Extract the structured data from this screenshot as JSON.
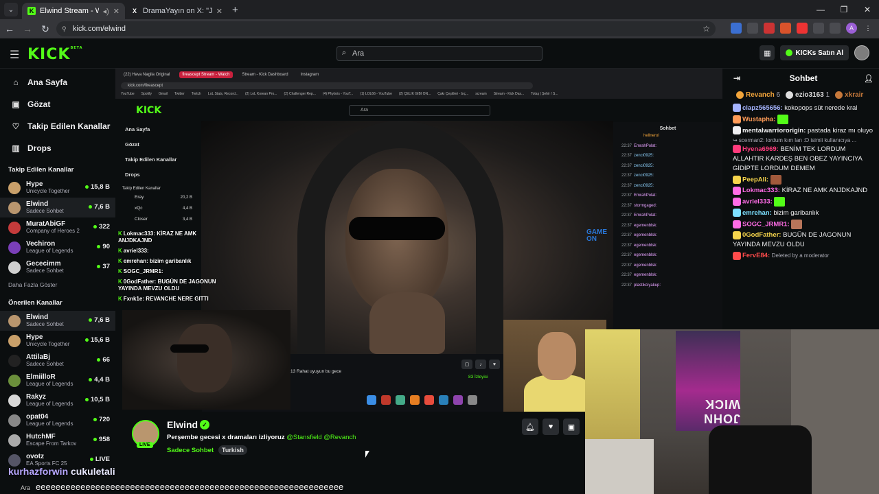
{
  "browser": {
    "tabs": [
      {
        "title": "Elwind Stream - Watch Live",
        "favicon": "K",
        "active": true
      },
      {
        "title": "DramaYayın on X: \"Jahrein ve G",
        "favicon": "X",
        "active": false
      }
    ],
    "url": "kick.com/elwind"
  },
  "topbar": {
    "logo": "KICK",
    "logo_sup": "BETA",
    "search_placeholder": "Ara",
    "kicks_button": "KICKs Satın Al"
  },
  "sidebar": {
    "nav": [
      {
        "label": "Ana Sayfa",
        "icon": "home-icon"
      },
      {
        "label": "Gözat",
        "icon": "browse-icon"
      },
      {
        "label": "Takip Edilen Kanallar",
        "icon": "heart-icon"
      },
      {
        "label": "Drops",
        "icon": "drops-icon"
      }
    ],
    "followed_title": "Takip Edilen Kanallar",
    "followed": [
      {
        "name": "Hype",
        "category": "Unicycle Together",
        "viewers": "15,8 B",
        "color": "#c9a06a"
      },
      {
        "name": "Elwind",
        "category": "Sadece Sohbet",
        "viewers": "7,6 B",
        "color": "#b9966e"
      },
      {
        "name": "MuratAbiGF",
        "category": "Company of Heroes 2",
        "viewers": "322",
        "color": "#c43b3b"
      },
      {
        "name": "Vechiron",
        "category": "League of Legends",
        "viewers": "90",
        "color": "#7a3fb8"
      },
      {
        "name": "Gececimm",
        "category": "Sadece Sohbet",
        "viewers": "37",
        "color": "#d0d0d0"
      }
    ],
    "more_label": "Daha Fazla Göster",
    "recommended_title": "Önerilen Kanallar",
    "recommended": [
      {
        "name": "Elwind",
        "category": "Sadece Sohbet",
        "viewers": "7,6 B",
        "color": "#b9966e"
      },
      {
        "name": "Hype",
        "category": "Unicycle Together",
        "viewers": "15,6 B",
        "color": "#c9a06a"
      },
      {
        "name": "AttilaBj",
        "category": "Sadece Sohbet",
        "viewers": "66",
        "color": "#222"
      },
      {
        "name": "ElmiilloR",
        "category": "League of Legends",
        "viewers": "4,4 B",
        "color": "#6b8f3b"
      },
      {
        "name": "Rakyz",
        "category": "League of Legends",
        "viewers": "10,5 B",
        "color": "#d8d8d8"
      },
      {
        "name": "opat04",
        "category": "League of Legends",
        "viewers": "720",
        "color": "#888"
      },
      {
        "name": "HutchMF",
        "category": "Escape From Tarkov",
        "viewers": "958",
        "color": "#aaa"
      },
      {
        "name": "ovotz",
        "category": "EA Sports FC 25",
        "viewers": "LIVE",
        "color": "#556"
      }
    ]
  },
  "inner_stream": {
    "tabs": [
      "(22) Hava Nagila Original",
      "fireascept Stream - Watch",
      "Stream - Kick Dashboard",
      "Instagram"
    ],
    "url": "kick.com/fireascept",
    "bookmarks": [
      "YouTube",
      "Spotify",
      "Gmail",
      "Twitter",
      "Twitch",
      "LoL Stats, Record...",
      "(2) LoL Korean Pro...",
      "(2) Challenger Rep...",
      "(4) Phylsris - YouT...",
      "(1) LOL66 - YouTube",
      "(2) ÇELIK GIBI ON...",
      "Çakı Çeşitleri - bıç...",
      "scream",
      "Stream - Kick Das...",
      "Totaş | Şehir / S..."
    ],
    "logo": "KICK",
    "search": "Ara",
    "nav": [
      "Ana Sayfa",
      "Gözat",
      "Takip Edilen Kanallar",
      "Drops"
    ],
    "followed_title": "Takip Edilen Kanallar",
    "followed": [
      {
        "name": "Eray",
        "cat": "Darbe Phone",
        "v": "20,2 B"
      },
      {
        "name": "xQc",
        "cat": "Minecraft",
        "v": "4,4 B"
      },
      {
        "name": "Closer",
        "cat": "",
        "v": "3,4 B"
      }
    ],
    "chat_title": "Sohbet",
    "chat_top": "hellnerol",
    "chat_lines": [
      {
        "t": "22:37",
        "u": "EmrahPolat:"
      },
      {
        "t": "22:37",
        "u": "zenci0925:"
      },
      {
        "t": "22:37",
        "u": "zenci0925:"
      },
      {
        "t": "22:37",
        "u": "zenci0925:"
      },
      {
        "t": "22:37",
        "u": "zenci0925:"
      },
      {
        "t": "22:37",
        "u": "EmrahPolat:"
      },
      {
        "t": "22:37",
        "u": "stormgaged:"
      },
      {
        "t": "22:37",
        "u": "EmrahPolat:"
      },
      {
        "t": "22:37",
        "u": "egemenblsk:"
      },
      {
        "t": "22:37",
        "u": "egemenblsk:"
      },
      {
        "t": "22:37",
        "u": "egemenblsk:"
      },
      {
        "t": "22:37",
        "u": "egemenblsk:"
      },
      {
        "t": "22:37",
        "u": "egemenblsk:"
      },
      {
        "t": "22:37",
        "u": "egemenblsk:"
      },
      {
        "t": "22:37",
        "u": "plastikciyakup:"
      }
    ],
    "game_on": [
      "GAME",
      "ON"
    ],
    "song": "13 Rahat uyuyun bu gece",
    "viewers": "83 İzleyici",
    "overlay_chat": [
      {
        "u": "Lokmac333:",
        "m": "KİRAZ NE AMK ANJDKAJND"
      },
      {
        "u": "avriel333:",
        "m": ""
      },
      {
        "u": "emrehan:",
        "m": "bizim garibanlık"
      },
      {
        "u": "SOGC_JRMR1:",
        "m": ""
      },
      {
        "u": "0GodFather:",
        "m": "BUGÜN DE JAGONUN YAYINDA MEVZU OLDU"
      },
      {
        "u": "Fxnk1e:",
        "m": "REVANCHE NERE GITTI"
      }
    ]
  },
  "channel_info": {
    "name": "Elwind",
    "live_label": "LIVE",
    "title": "Perşembe gecesi x dramaları izliyoruz",
    "mention1": "@Stansfield",
    "mention2": "@Revanch",
    "category": "Sadece Sohbet",
    "tag": "Turkish"
  },
  "bottom_overlay": {
    "user": "kurhazforwin",
    "message": "cukuletali",
    "spam": "eeeeeeeeeeeeeeeeeeeeeeeeeeeeeeeeeeeeeeeeeeeeeeeeeeeeeeeeeeeeee",
    "search_text": "Ara"
  },
  "chat": {
    "title": "Sohbet",
    "pinned": [
      {
        "name": "Revanch",
        "n": "6",
        "color": "#f2a53b"
      },
      {
        "name": "ezio3163",
        "n": "1",
        "color": "#ddd"
      },
      {
        "name": "xkrair",
        "n": "",
        "color": "#c7793b"
      }
    ],
    "messages": [
      {
        "user": "clapz565656:",
        "color": "#a5b4ff",
        "text": "kokopops süt nerede kral"
      },
      {
        "user": "Wustapha:",
        "color": "#ff9b57",
        "text": ""
      },
      {
        "user": "mentalwarriororigin:",
        "color": "#efeff1",
        "text": "pastada kiraz mı oluyo"
      },
      {
        "reply": "scerman2: lordum kım lan :D isimli kullanıcıya ..."
      },
      {
        "user": "Hyena6969:",
        "color": "#ff3b7c",
        "text": "BENİM TEK LORDUM ALLAHTIR KARDEŞ BEN OBEZ YAYINCIYA GİDİPTE LORDUM DEMEM"
      },
      {
        "user": "PeepAli:",
        "color": "#f5d44c",
        "text": ""
      },
      {
        "user": "Lokmac333:",
        "color": "#ff6ce6",
        "text": "KİRAZ NE AMK ANJDKAJND"
      },
      {
        "user": "avriel333:",
        "color": "#ff6ce6",
        "text": ""
      },
      {
        "user": "emrehan:",
        "color": "#7de0ff",
        "text": "bizim garibanlık"
      },
      {
        "user": "SOGC_JRMR1:",
        "color": "#ff6ce6",
        "text": ""
      },
      {
        "user": "0GodFather:",
        "color": "#f5d44c",
        "text": "BUGÜN DE JAGONUN YAYINDA MEVZU OLDU"
      },
      {
        "user": "FervE84:",
        "color": "#ff4b4b",
        "text": "",
        "deleted": "Deleted by a moderator"
      }
    ]
  },
  "webcam_poster_text": "JOHN WICK"
}
